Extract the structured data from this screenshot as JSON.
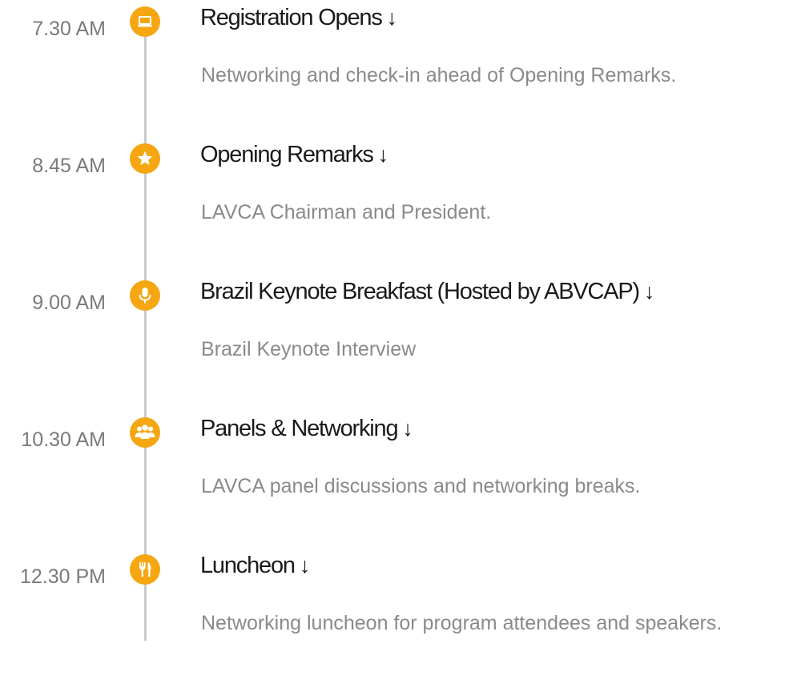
{
  "colors": {
    "accent": "#f5a611",
    "line": "#c8c9cd",
    "time_text": "#7a7a7a",
    "title_text": "#1a1a1a",
    "desc_text": "#8a8a8a"
  },
  "expand_arrow": "↓",
  "events": [
    {
      "time": "7.30 AM",
      "icon": "laptop-icon",
      "title": "Registration Opens",
      "description": "Networking and check-in ahead of Opening Remarks."
    },
    {
      "time": "8.45 AM",
      "icon": "star-icon",
      "title": "Opening Remarks",
      "description": "LAVCA Chairman and President."
    },
    {
      "time": "9.00 AM",
      "icon": "microphone-icon",
      "title": "Brazil Keynote Breakfast (Hosted by ABVCAP)",
      "description": "Brazil Keynote Interview"
    },
    {
      "time": "10.30 AM",
      "icon": "group-icon",
      "title": "Panels & Networking",
      "description": "LAVCA panel discussions and networking breaks."
    },
    {
      "time": "12.30 PM",
      "icon": "utensils-icon",
      "title": "Luncheon",
      "description": "Networking luncheon for program attendees and speakers."
    }
  ]
}
